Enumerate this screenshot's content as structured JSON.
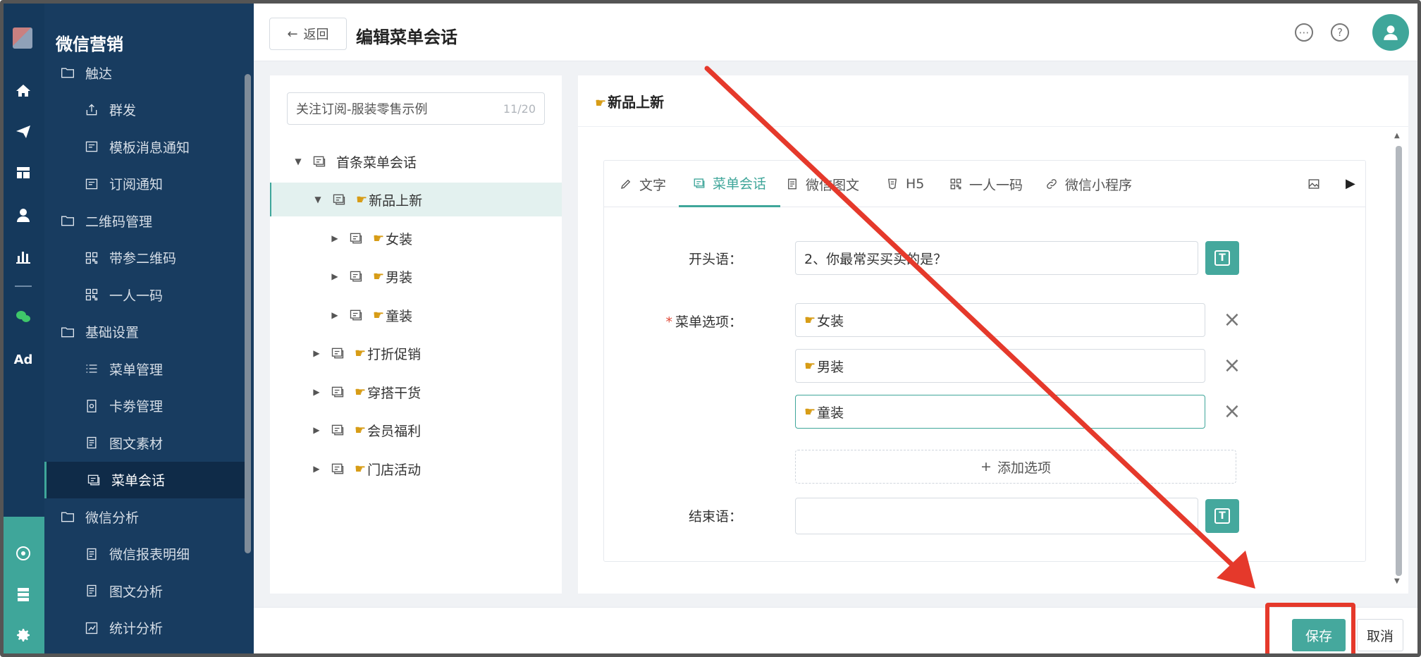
{
  "brand": "微信营销",
  "sidebar": {
    "items": [
      {
        "label": "触达",
        "icon": "folder-icon",
        "level": 1
      },
      {
        "label": "群发",
        "icon": "share-upload-icon",
        "level": 2
      },
      {
        "label": "模板消息通知",
        "icon": "message-card-icon",
        "level": 2
      },
      {
        "label": "订阅通知",
        "icon": "message-card-icon",
        "level": 2
      },
      {
        "label": "二维码管理",
        "icon": "folder-icon",
        "level": 1
      },
      {
        "label": "带参二维码",
        "icon": "qrcode-icon",
        "level": 2
      },
      {
        "label": "一人一码",
        "icon": "qrcode-icon",
        "level": 2
      },
      {
        "label": "基础设置",
        "icon": "folder-icon",
        "level": 1
      },
      {
        "label": "菜单管理",
        "icon": "list-icon",
        "level": 2
      },
      {
        "label": "卡劵管理",
        "icon": "coupon-icon",
        "level": 2
      },
      {
        "label": "图文素材",
        "icon": "document-icon",
        "level": 2
      },
      {
        "label": "菜单会话",
        "icon": "chat-menu-icon",
        "level": 2,
        "active": true
      },
      {
        "label": "微信分析",
        "icon": "folder-icon",
        "level": 1
      },
      {
        "label": "微信报表明细",
        "icon": "document-icon",
        "level": 2
      },
      {
        "label": "图文分析",
        "icon": "document-icon",
        "level": 2
      },
      {
        "label": "统计分析",
        "icon": "chart-icon",
        "level": 2
      }
    ]
  },
  "header": {
    "back_label": "返回",
    "title": "编辑菜单会话"
  },
  "tree": {
    "search_value": "关注订阅-服装零售示例",
    "search_count": "11/20",
    "rows": [
      {
        "label": "首条菜单会话",
        "hand": false
      },
      {
        "label": "新品上新",
        "hand": true
      },
      {
        "label": "女装",
        "hand": true
      },
      {
        "label": "男装",
        "hand": true
      },
      {
        "label": "童装",
        "hand": true
      },
      {
        "label": "打折促销",
        "hand": true
      },
      {
        "label": "穿搭干货",
        "hand": true
      },
      {
        "label": "会员福利",
        "hand": true
      },
      {
        "label": "门店活动",
        "hand": true
      }
    ]
  },
  "editor": {
    "title": "新品上新",
    "tabs": [
      {
        "label": "文字",
        "icon": "pencil-icon"
      },
      {
        "label": "菜单会话",
        "icon": "chat-menu-icon",
        "active": true
      },
      {
        "label": "微信图文",
        "icon": "document-icon"
      },
      {
        "label": "H5",
        "icon": "html5-icon"
      },
      {
        "label": "一人一码",
        "icon": "qrcode-icon"
      },
      {
        "label": "微信小程序",
        "icon": "link-icon"
      }
    ],
    "opening_label": "开头语：",
    "opening_value": "2、你最常买买买的是？",
    "menu_label": "菜单选项：",
    "options": [
      "女装",
      "男装",
      "童装"
    ],
    "add_option": "添加选项",
    "ending_label": "结束语：",
    "ending_value": ""
  },
  "footer": {
    "save_label": "保存",
    "cancel_label": "取消"
  },
  "colors": {
    "accent": "#45a89d",
    "sidebar_bg": "#183c60",
    "annotation_red": "#e5392b"
  }
}
